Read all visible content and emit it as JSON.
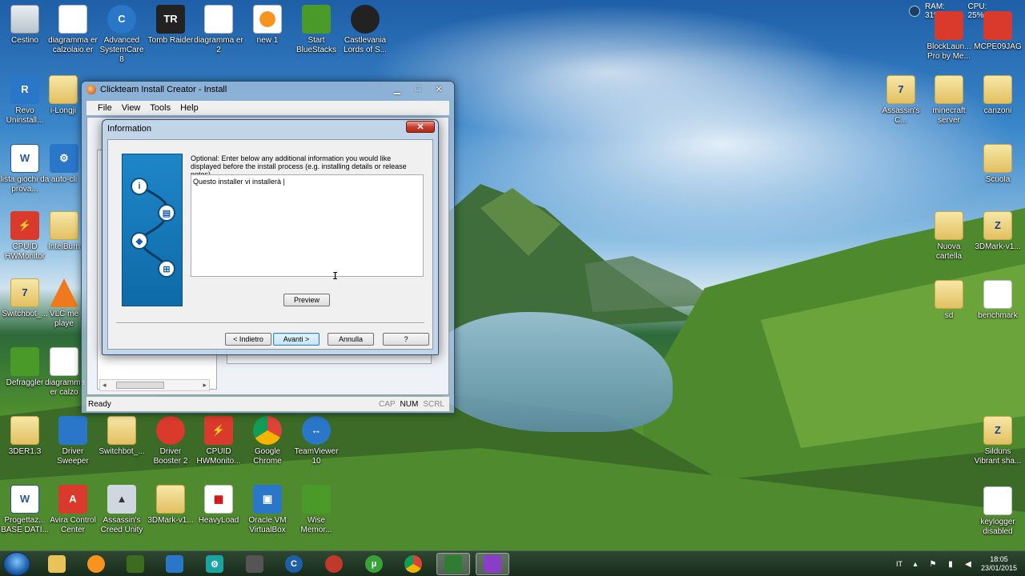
{
  "desktop": {
    "left_icons": [
      {
        "label": "Cestino",
        "glyph": "",
        "icon": "recycle-bin-icon"
      },
      {
        "label": "diagramma er calzolaio.er",
        "glyph": "",
        "icon": "document-icon"
      },
      {
        "label": "Advanced SystemCare 8",
        "glyph": "C",
        "icon": "advanced-systemcare-icon"
      },
      {
        "label": "Tomb Raider",
        "glyph": "TR",
        "icon": "tomb-raider-icon"
      },
      {
        "label": "diagramma er 2",
        "glyph": "",
        "icon": "document-icon"
      },
      {
        "label": "new 1",
        "glyph": "",
        "icon": "firefox-document-icon"
      },
      {
        "label": "Start BlueStacks",
        "glyph": "",
        "icon": "bluestacks-icon"
      },
      {
        "label": "Castlevania Lords of S...",
        "glyph": "",
        "icon": "castlevania-icon"
      },
      {
        "label": "Revo Uninstall...",
        "glyph": "R",
        "icon": "revo-uninstaller-icon"
      },
      {
        "label": "i-Longji",
        "glyph": "",
        "icon": "folder-icon"
      },
      {
        "label": "lista giochi da prova...",
        "glyph": "W",
        "icon": "word-document-icon"
      },
      {
        "label": "auto-cli",
        "glyph": "",
        "icon": "gear-icon"
      },
      {
        "label": "CPUID HWMonitor",
        "glyph": "",
        "icon": "hwmonitor-icon"
      },
      {
        "label": "IntelBurn",
        "glyph": "",
        "icon": "folder-icon"
      },
      {
        "label": "Switchbot_...",
        "glyph": "7",
        "icon": "archive-icon"
      },
      {
        "label": "VLC me playe",
        "glyph": "",
        "icon": "vlc-icon"
      },
      {
        "label": "Defraggler",
        "glyph": "",
        "icon": "defraggler-icon"
      },
      {
        "label": "diagramma er calzo",
        "glyph": "",
        "icon": "document-icon"
      },
      {
        "label": "3DER1.3",
        "glyph": "",
        "icon": "folder-icon"
      },
      {
        "label": "Driver Sweeper",
        "glyph": "",
        "icon": "driver-sweeper-icon"
      },
      {
        "label": "Switchbot_...",
        "glyph": "",
        "icon": "folder-icon"
      },
      {
        "label": "Driver Booster 2",
        "glyph": "",
        "icon": "driver-booster-icon"
      },
      {
        "label": "CPUID HWMonito...",
        "glyph": "",
        "icon": "hwmonitor-icon"
      },
      {
        "label": "Google Chrome",
        "glyph": "",
        "icon": "chrome-icon"
      },
      {
        "label": "TeamViewer 10",
        "glyph": "",
        "icon": "teamviewer-icon"
      },
      {
        "label": "Progettaz... BASE DATI...",
        "glyph": "W",
        "icon": "word-document-icon"
      },
      {
        "label": "Avira Control Center",
        "glyph": "A",
        "icon": "avira-icon"
      },
      {
        "label": "Assassin's Creed Unity",
        "glyph": "",
        "icon": "assassins-creed-icon"
      },
      {
        "label": "3DMark-v1...",
        "glyph": "",
        "icon": "archive-icon"
      },
      {
        "label": "HeavyLoad",
        "glyph": "",
        "icon": "heavyload-icon"
      },
      {
        "label": "Oracle VM VirtualBox",
        "glyph": "",
        "icon": "virtualbox-icon"
      },
      {
        "label": "Wise Memor...",
        "glyph": "",
        "icon": "wise-memory-icon"
      }
    ],
    "right_icons": [
      {
        "label": "BlockLaun... Pro by Me...",
        "glyph": "",
        "icon": "blocklauncher-icon"
      },
      {
        "label": "MCPE09JAG",
        "glyph": "",
        "icon": "mcpe-icon"
      },
      {
        "label": "Assassin's C...",
        "glyph": "7",
        "icon": "archive-icon"
      },
      {
        "label": "minecraft server",
        "glyph": "",
        "icon": "folder-icon"
      },
      {
        "label": "canzoni",
        "glyph": "",
        "icon": "folder-icon"
      },
      {
        "label": "Scuola",
        "glyph": "",
        "icon": "folder-icon"
      },
      {
        "label": "Nuova cartella",
        "glyph": "",
        "icon": "folder-icon"
      },
      {
        "label": "3DMark-v1...",
        "glyph": "Z",
        "icon": "archive-icon"
      },
      {
        "label": "sd",
        "glyph": "",
        "icon": "folder-icon"
      },
      {
        "label": "benchmark",
        "glyph": "",
        "icon": "document-icon"
      },
      {
        "label": "Silduns Vibrant sha...",
        "glyph": "Z",
        "icon": "archive-icon"
      },
      {
        "label": "keylogger disabled",
        "glyph": "",
        "icon": "document-icon"
      }
    ],
    "gadget": {
      "ram": "RAM: 31%",
      "cpu": "CPU: 25%"
    }
  },
  "main_window": {
    "title": "Clickteam Install Creator - Install",
    "menu": [
      "File",
      "View",
      "Tools",
      "Help"
    ],
    "status": "Ready",
    "keys": [
      "CAP",
      "NUM",
      "SCRL"
    ]
  },
  "dialog": {
    "title": "Information",
    "instructions": "Optional: Enter below any additional information you would like displayed before the install process (e.g. installing details or release notes).",
    "notes_value": "Questo installer vi installerà |",
    "preview_label": "Preview",
    "back_label": "< Indietro",
    "next_label": "Avanti >",
    "cancel_label": "Annulla",
    "help_label": "?"
  },
  "taskbar": {
    "language": "IT",
    "time": "18:05",
    "date": "23/01/2015"
  }
}
